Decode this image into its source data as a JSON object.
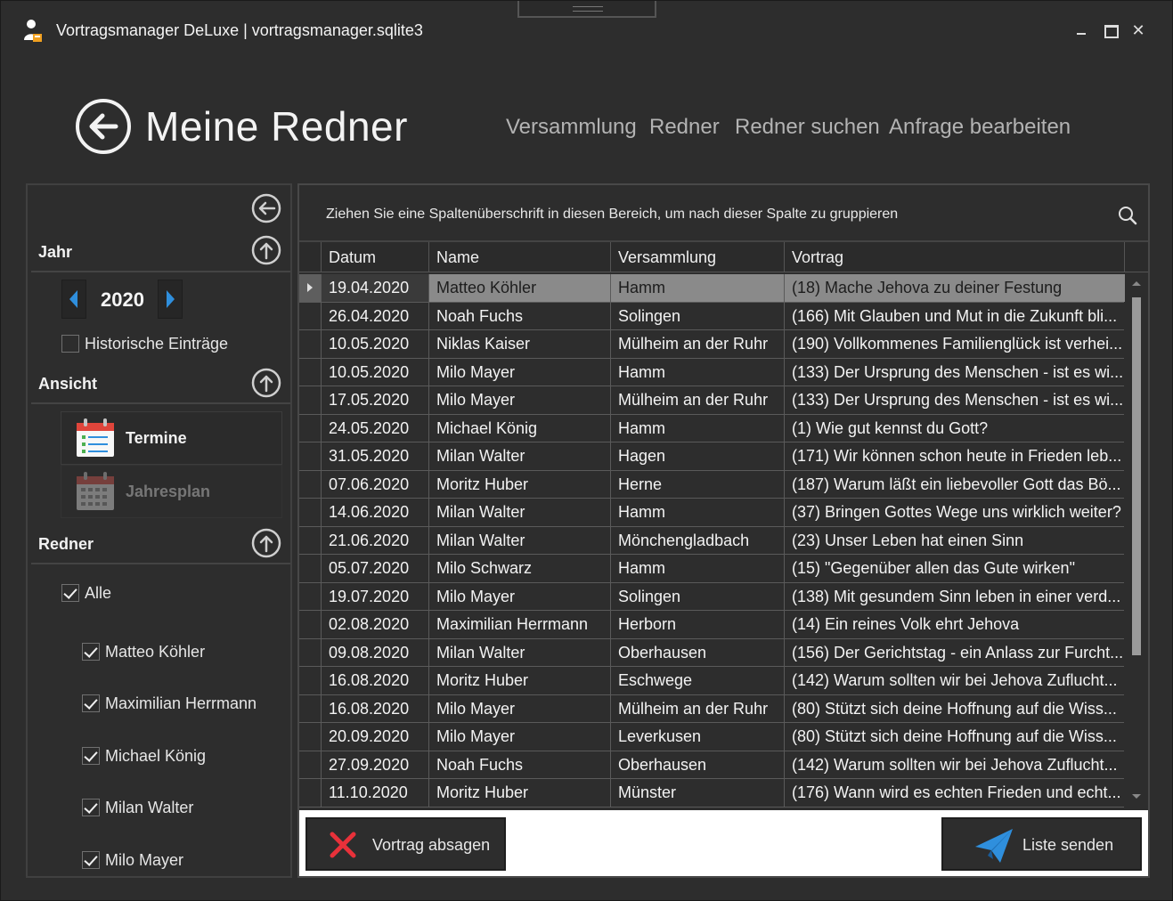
{
  "window": {
    "title": "Vortragsmanager DeLuxe | vortragsmanager.sqlite3",
    "minimize": "",
    "maximize": "",
    "close": "✕"
  },
  "header": {
    "title": "Meine Redner",
    "nav": [
      "Versammlung",
      "Redner",
      "Redner suchen",
      "Anfrage bearbeiten"
    ]
  },
  "sidebar": {
    "jahr_title": "Jahr",
    "year": "2020",
    "historic_label": "Historische Einträge",
    "historic_checked": false,
    "ansicht_title": "Ansicht",
    "view_termine": "Termine",
    "view_jahresplan": "Jahresplan",
    "redner_title": "Redner",
    "alle_label": "Alle",
    "speakers": [
      "Matteo Köhler",
      "Maximilian Herrmann",
      "Michael König",
      "Milan Walter",
      "Milo Mayer"
    ]
  },
  "grid": {
    "group_hint": "Ziehen Sie eine Spaltenüberschrift in diesen Bereich, um nach dieser Spalte zu gruppieren",
    "columns": [
      "Datum",
      "Name",
      "Versammlung",
      "Vortrag"
    ],
    "rows": [
      [
        "19.04.2020",
        "Matteo Köhler",
        "Hamm",
        "(18) Mache Jehova zu deiner Festung"
      ],
      [
        "26.04.2020",
        "Noah Fuchs",
        "Solingen",
        "(166) Mit Glauben und Mut in die Zukunft bli..."
      ],
      [
        "10.05.2020",
        "Niklas Kaiser",
        "Mülheim an der Ruhr",
        "(190) Vollkommenes Familienglück ist verhei..."
      ],
      [
        "10.05.2020",
        "Milo Mayer",
        "Hamm",
        "(133) Der Ursprung des Menschen - ist es wi..."
      ],
      [
        "17.05.2020",
        "Milo Mayer",
        "Mülheim an der Ruhr",
        "(133) Der Ursprung des Menschen - ist es wi..."
      ],
      [
        "24.05.2020",
        "Michael König",
        "Hamm",
        "(1) Wie gut kennst du Gott?"
      ],
      [
        "31.05.2020",
        "Milan Walter",
        "Hagen",
        "(171) Wir können schon heute in Frieden leb..."
      ],
      [
        "07.06.2020",
        "Moritz Huber",
        "Herne",
        "(187) Warum läßt ein liebevoller Gott das Bö..."
      ],
      [
        "14.06.2020",
        "Milan Walter",
        "Hamm",
        "(37) Bringen Gottes Wege uns wirklich weiter?"
      ],
      [
        "21.06.2020",
        "Milan Walter",
        "Mönchengladbach",
        "(23) Unser Leben hat einen Sinn"
      ],
      [
        "05.07.2020",
        "Milo Schwarz",
        "Hamm",
        "(15) \"Gegenüber allen das Gute wirken\""
      ],
      [
        "19.07.2020",
        "Milo Mayer",
        "Solingen",
        "(138) Mit gesundem Sinn leben in einer verd..."
      ],
      [
        "02.08.2020",
        "Maximilian Herrmann",
        "Herborn",
        "(14) Ein reines Volk ehrt Jehova"
      ],
      [
        "09.08.2020",
        "Milan Walter",
        "Oberhausen",
        "(156) Der Gerichtstag - ein Anlass zur Furcht..."
      ],
      [
        "16.08.2020",
        "Moritz Huber",
        "Eschwege",
        "(142) Warum sollten wir bei Jehova Zuflucht..."
      ],
      [
        "16.08.2020",
        "Milo Mayer",
        "Mülheim an der Ruhr",
        "(80) Stützt sich deine Hoffnung auf die Wiss..."
      ],
      [
        "20.09.2020",
        "Milo Mayer",
        "Leverkusen",
        "(80) Stützt sich deine Hoffnung auf die Wiss..."
      ],
      [
        "27.09.2020",
        "Noah Fuchs",
        "Oberhausen",
        "(142) Warum sollten wir bei Jehova Zuflucht..."
      ],
      [
        "11.10.2020",
        "Moritz Huber",
        "Münster",
        "(176) Wann wird es echten Frieden und echt..."
      ]
    ],
    "selected_row": 0
  },
  "actions": {
    "cancel_label": "Vortrag absagen",
    "send_label": "Liste senden"
  },
  "colors": {
    "background": "#2d2d2d",
    "accent_blue": "#2f8fdd",
    "cancel_red": "#e8313a",
    "selected_row": "#8a8a8a"
  },
  "icons": [
    "app-icon",
    "back-arrow-icon",
    "search-icon",
    "collapse-left-icon",
    "collapse-up-icon",
    "calendar-list-icon",
    "calendar-grid-icon",
    "close-x-icon",
    "paper-plane-icon"
  ]
}
